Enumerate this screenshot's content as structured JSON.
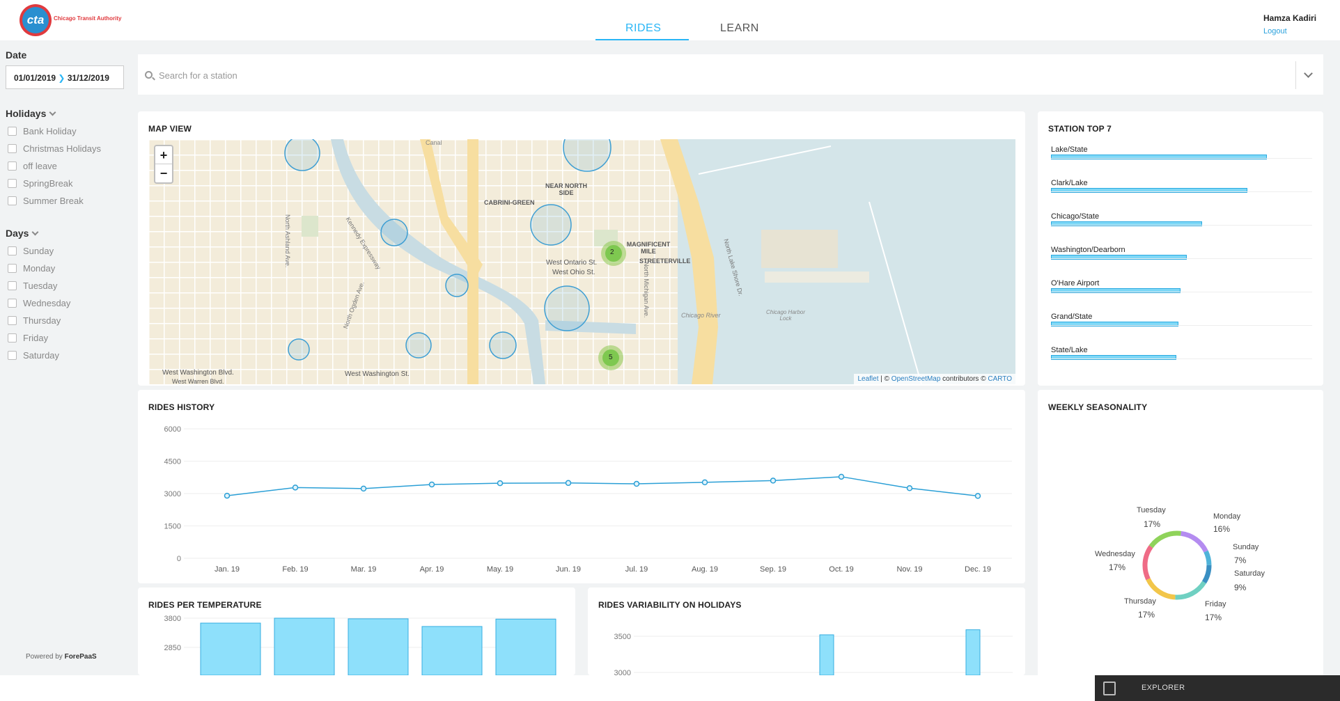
{
  "header": {
    "logo_text": "cta",
    "logo_caption": "Chicago Transit Authority",
    "tabs": [
      {
        "label": "RIDES",
        "active": true
      },
      {
        "label": "LEARN",
        "active": false
      }
    ],
    "user_name": "Hamza Kadiri",
    "logout_label": "Logout"
  },
  "sidebar": {
    "date_title": "Date",
    "date_start": "01/01/2019",
    "date_end": "31/12/2019",
    "holidays_title": "Holidays",
    "holidays": [
      "Bank Holiday",
      "Christmas Holidays",
      "off leave",
      "SpringBreak",
      "Summer Break"
    ],
    "days_title": "Days",
    "days": [
      "Sunday",
      "Monday",
      "Tuesday",
      "Wednesday",
      "Thursday",
      "Friday",
      "Saturday"
    ],
    "powered_by": "Powered by",
    "powered_brand": "ForePaaS"
  },
  "search": {
    "placeholder": "Search for a station"
  },
  "map": {
    "title": "MAP VIEW",
    "zoom_in": "+",
    "zoom_out": "−",
    "attribution_leaflet": "Leaflet",
    "attribution_mid": " | © ",
    "attribution_osm": "OpenStreetMap",
    "attribution_contrib": " contributors © ",
    "attribution_carto": "CARTO",
    "labels": [
      "Canal",
      "NEAR NORTH SIDE",
      "CABRINI-GREEN",
      "MAGNIFICENT MILE",
      "STREETERVILLE",
      "West Ontario St.",
      "West Ohio St.",
      "Kennedy Expressway",
      "North Ashland Ave.",
      "North Ogden Ave.",
      "North Michigan Ave.",
      "North Lake Shore Dr.",
      "Chicago River",
      "Chicago Harbor Lock",
      "West Washington Blvd.",
      "West Warren Blvd.",
      "West Washington St."
    ],
    "clusters": [
      "2",
      "5"
    ]
  },
  "station_top": {
    "title": "STATION TOP 7",
    "items": [
      {
        "name": "Lake/State",
        "value": 1.0
      },
      {
        "name": "Clark/Lake",
        "value": 0.91
      },
      {
        "name": "Chicago/State",
        "value": 0.7
      },
      {
        "name": "Washington/Dearborn",
        "value": 0.63
      },
      {
        "name": "O'Hare Airport",
        "value": 0.6
      },
      {
        "name": "Grand/State",
        "value": 0.59
      },
      {
        "name": "State/Lake",
        "value": 0.58
      }
    ]
  },
  "rides_history": {
    "title": "RIDES HISTORY"
  },
  "weekly": {
    "title": "WEEKLY SEASONALITY",
    "slices": [
      {
        "day": "Monday",
        "pct": "16%",
        "color": "#b48cf0"
      },
      {
        "day": "Sunday",
        "pct": "7%",
        "color": "#4fb3d9"
      },
      {
        "day": "Saturday",
        "pct": "9%",
        "color": "#3a8fc2"
      },
      {
        "day": "Friday",
        "pct": "17%",
        "color": "#6fd0c2"
      },
      {
        "day": "Thursday",
        "pct": "17%",
        "color": "#f2c64a"
      },
      {
        "day": "Wednesday",
        "pct": "17%",
        "color": "#ef6b86"
      },
      {
        "day": "Tuesday",
        "pct": "17%",
        "color": "#8fd35a"
      }
    ]
  },
  "rides_temp": {
    "title": "RIDES PER TEMPERATURE"
  },
  "rides_holidays": {
    "title": "RIDES VARIABILITY ON HOLIDAYS"
  },
  "explorer": {
    "label": "EXPLORER"
  },
  "chart_data": [
    {
      "type": "line",
      "title": "RIDES HISTORY",
      "categories": [
        "Jan. 19",
        "Feb. 19",
        "Mar. 19",
        "Apr. 19",
        "May. 19",
        "Jun. 19",
        "Jul. 19",
        "Aug. 19",
        "Sep. 19",
        "Oct. 19",
        "Nov. 19",
        "Dec. 19"
      ],
      "values": [
        2900,
        3280,
        3230,
        3420,
        3480,
        3490,
        3450,
        3520,
        3600,
        3780,
        3250,
        2890
      ],
      "yticks": [
        0,
        1500,
        3000,
        4500,
        6000
      ],
      "ylim": [
        0,
        6000
      ],
      "color": "#2a9fd6"
    },
    {
      "type": "bar",
      "title": "RIDES PER TEMPERATURE",
      "values": [
        3640,
        3800,
        3780,
        3530,
        3770
      ],
      "yticks": [
        2850,
        3800
      ],
      "ylim": [
        1900,
        3800
      ]
    },
    {
      "type": "bar",
      "title": "RIDES VARIABILITY ON HOLIDAYS",
      "values": [
        3520,
        3590
      ],
      "yticks": [
        3000,
        3500
      ]
    },
    {
      "type": "pie",
      "title": "WEEKLY SEASONALITY",
      "categories": [
        "Monday",
        "Sunday",
        "Saturday",
        "Friday",
        "Thursday",
        "Wednesday",
        "Tuesday"
      ],
      "values": [
        16,
        7,
        9,
        17,
        17,
        17,
        17
      ]
    }
  ]
}
